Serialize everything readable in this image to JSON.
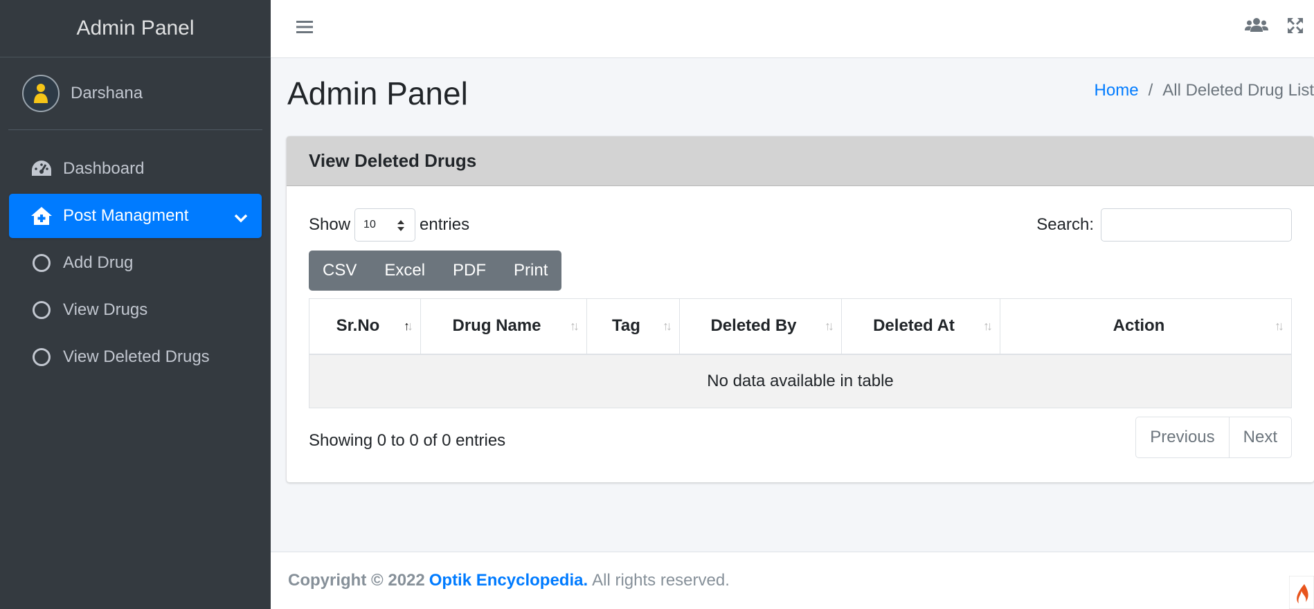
{
  "sidebar": {
    "brand": "Admin Panel",
    "user_name": "Darshana",
    "items": [
      {
        "label": "Dashboard",
        "icon": "dashboard-gauge-icon"
      },
      {
        "label": "Post Managment",
        "icon": "home-plus-icon"
      },
      {
        "label": "Add Drug",
        "icon": "circle-icon"
      },
      {
        "label": "View Drugs",
        "icon": "circle-icon"
      },
      {
        "label": "View Deleted Drugs",
        "icon": "circle-icon"
      }
    ],
    "active_index": 1,
    "accent_color": "#007bff"
  },
  "header": {
    "icons": [
      "hamburger-icon",
      "users-icon",
      "fullscreen-icon"
    ]
  },
  "page": {
    "title": "Admin Panel",
    "breadcrumb": {
      "home": "Home",
      "separator": "/",
      "current": "All Deleted Drug List"
    }
  },
  "card": {
    "title": "View Deleted Drugs",
    "length": {
      "prefix": "Show",
      "value": "10",
      "suffix": "entries"
    },
    "search_label": "Search:",
    "search_value": "",
    "buttons": [
      "CSV",
      "Excel",
      "PDF",
      "Print"
    ],
    "columns": [
      "Sr.No",
      "Drug Name",
      "Tag",
      "Deleted By",
      "Deleted At",
      "Action"
    ],
    "empty_message": "No data available in table",
    "info": "Showing 0 to 0 of 0 entries",
    "pagination": {
      "previous": "Previous",
      "next": "Next"
    }
  },
  "footer": {
    "copyright": "Copyright © 2022",
    "brand": "Optik Encyclopedia.",
    "rights": "All rights reserved."
  }
}
